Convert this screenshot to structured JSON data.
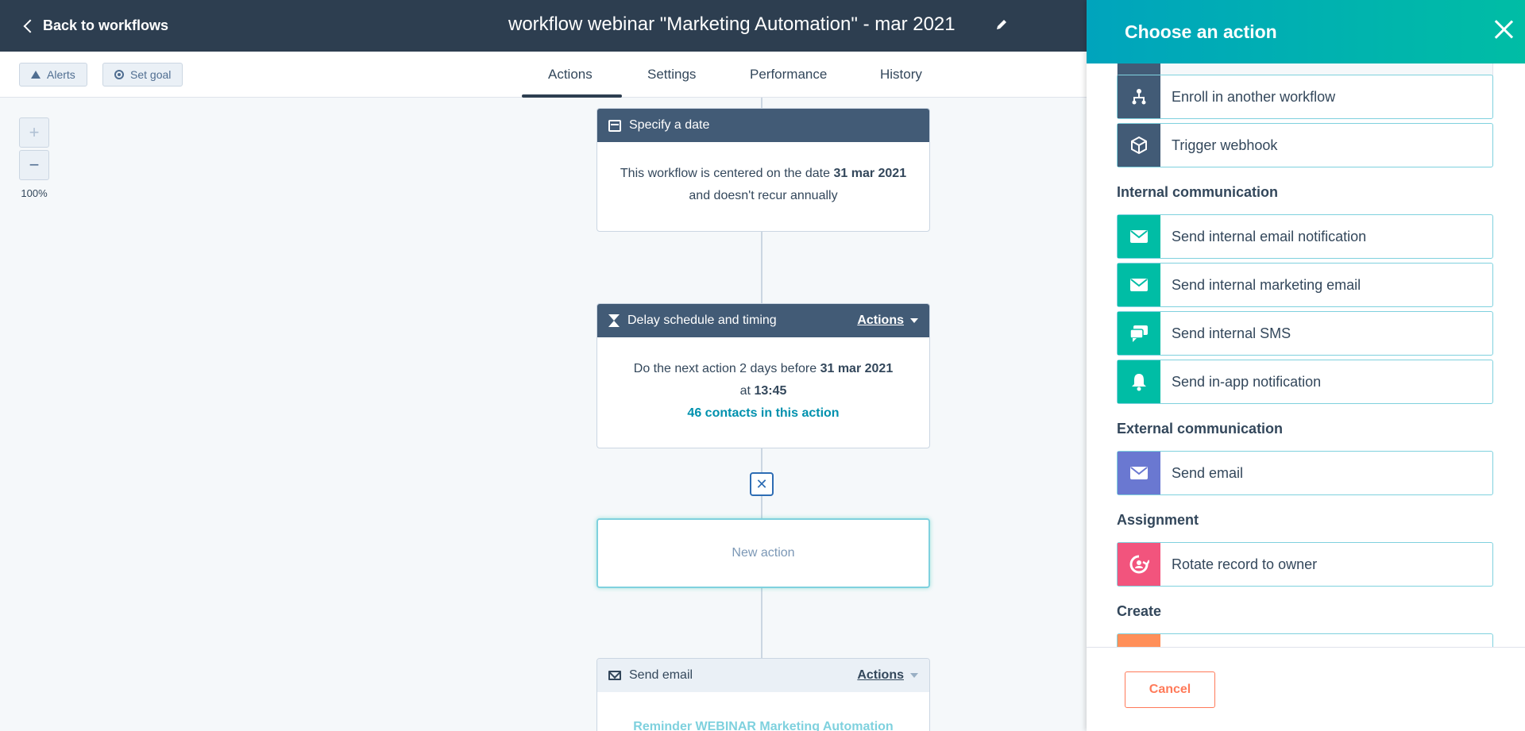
{
  "header": {
    "back_label": "Back to workflows",
    "title": "workflow webinar \"Marketing Automation\" - mar 2021"
  },
  "toolbar": {
    "alerts_label": "Alerts",
    "goal_label": "Set goal",
    "tabs": [
      "Actions",
      "Settings",
      "Performance",
      "History"
    ],
    "active_tab": "Actions"
  },
  "zoom": {
    "plus": "+",
    "minus": "−",
    "level": "100%"
  },
  "canvas": {
    "date_card": {
      "title": "Specify a date",
      "text_before": "This workflow is centered on the date ",
      "date": "31 mar 2021",
      "text_after": " and doesn't recur annually"
    },
    "delay_card": {
      "title": "Delay schedule and timing",
      "actions_label": "Actions",
      "text_before": "Do the next action 2 days before ",
      "date": "31 mar 2021",
      "text_mid": " at ",
      "time": "13:45",
      "contacts": "46 contacts in this action"
    },
    "remove_symbol": "✕",
    "new_action_label": "New action",
    "email_card": {
      "title": "Send email",
      "actions_label": "Actions",
      "email_name": "Reminder WEBINAR Marketing Automation"
    }
  },
  "panel": {
    "title": "Choose an action",
    "actions_top": [
      {
        "label": "Enroll in another workflow",
        "icon": "workflow-tree-icon"
      },
      {
        "label": "Trigger webhook",
        "icon": "cube-icon"
      }
    ],
    "sections": [
      {
        "title": "Internal communication",
        "items": [
          {
            "label": "Send internal email notification",
            "icon": "envelope-icon"
          },
          {
            "label": "Send internal marketing email",
            "icon": "envelope-icon"
          },
          {
            "label": "Send internal SMS",
            "icon": "chat-icon"
          },
          {
            "label": "Send in-app notification",
            "icon": "bell-icon"
          }
        ]
      },
      {
        "title": "External communication",
        "items": [
          {
            "label": "Send email",
            "icon": "envelope-icon"
          }
        ]
      },
      {
        "title": "Assignment",
        "items": [
          {
            "label": "Rotate record to owner",
            "icon": "rotate-icon"
          }
        ]
      },
      {
        "title": "Create",
        "items": []
      }
    ],
    "cancel_label": "Cancel"
  },
  "colors": {
    "header_bg": "#2d3e50",
    "card_head": "#425b76",
    "teal": "#00bda5",
    "purple": "#6a78d1",
    "pink": "#f2547d",
    "orange": "#ff8f59",
    "link": "#0091ae",
    "cancel": "#ff7a59"
  }
}
